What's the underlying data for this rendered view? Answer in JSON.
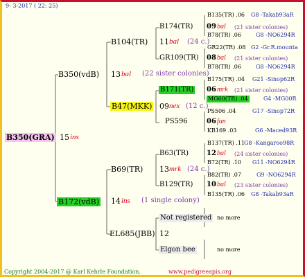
{
  "header": {
    "date": "9- 3-2017 ( 22: 25)"
  },
  "footer": {
    "copyright": "Copyright 2004-2017 @ Karl Kehrle Foundation.",
    "url": "www.pedigreeapis.org"
  },
  "root": {
    "name": "B350(GRA)",
    "num": "15",
    "tag": "ins"
  },
  "gen1": {
    "sire": {
      "name": "B350(vdB)",
      "num": "13",
      "tag": "bal",
      "note": "(22 sister colonies)"
    },
    "dam": {
      "name": "B172(vdB)",
      "num": "14",
      "tag": "ins",
      "note": "(1 single colony)"
    }
  },
  "gen2": {
    "a": {
      "name": "B104(TR)",
      "num": "11",
      "tag": "bal",
      "note": "(24 c.)"
    },
    "b": {
      "name": "B47(MKK)",
      "num": "09",
      "tag": "nex",
      "note": "(12 c.)"
    },
    "c": {
      "name": "B69(TR)",
      "num": "13",
      "tag": "mrk",
      "note": "(24 c.)"
    },
    "d": {
      "name": "EL685(JBB)",
      "num": "12"
    }
  },
  "gen3": {
    "a": {
      "name": "B174(TR)",
      "num": "09",
      "tag": "bal",
      "note": "(21 sister colonies)"
    },
    "b": {
      "name": "GR109(TR)",
      "num": "08",
      "tag": "bal",
      "note": "(21 sister colonies)"
    },
    "c": {
      "name": "B171(TR)",
      "num": "06",
      "tag": "mrk",
      "note": "(21 sister colonies)"
    },
    "d": {
      "name": "PS596",
      "num": "06",
      "tag": "fun"
    },
    "e": {
      "name": "B63(TR)",
      "num": "12",
      "tag": "bal",
      "note": "(24 sister colonies)"
    },
    "f": {
      "name": "B129(TR)",
      "num": "10",
      "tag": "bal",
      "note": "(23 sister colonies)"
    },
    "g": {
      "name": "Not registered",
      "more": "no more"
    },
    "h": {
      "name": "Elgon bee",
      "more": "no more"
    }
  },
  "gen4": [
    {
      "left": "B135(TR) .06",
      "right": "G8 -Takab93aR"
    },
    {
      "left": "B78(TR) .06",
      "right": "G8 -NO6294R"
    },
    {
      "left": "GR22(TR) .08",
      "right": "G2 -Gr.R.mounta"
    },
    {
      "left": "B78(TR) .06",
      "right": "G8 -NO6294R"
    },
    {
      "left": "B175(TR) .04",
      "right": "G21 -Sinop62R"
    },
    {
      "left": "MG60(TR) .04",
      "right": "G4 -MG00R"
    },
    {
      "left": "PS506 .04",
      "right": "G17 -Sinop72R"
    },
    {
      "left": "KB169 .03",
      "right": "G6 -Maced93R"
    },
    {
      "left": "B137(TR) .11",
      "right": "G8 -Kangaroo98R"
    },
    {
      "left": "B72(TR) .10",
      "right": "G11 -NO6294R"
    },
    {
      "left": "B82(TR) .07",
      "right": "G9 -NO6294R"
    },
    {
      "left": "B135(TR) .06",
      "right": "G8 -Takab93aR"
    }
  ]
}
